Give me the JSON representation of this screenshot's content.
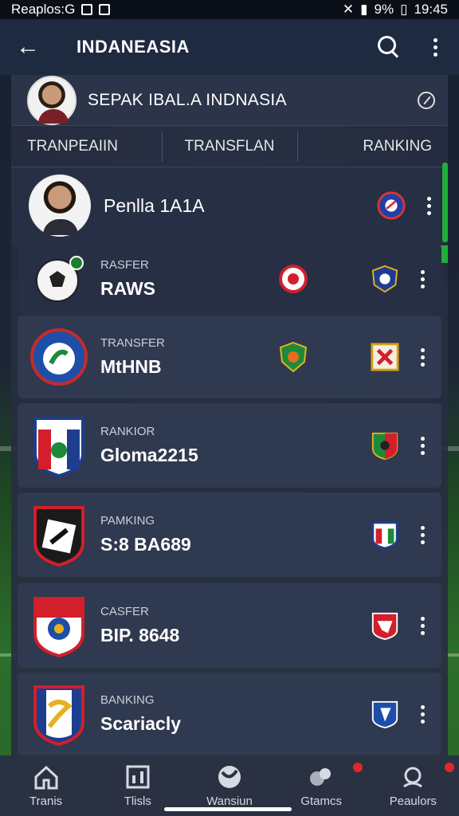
{
  "status_bar": {
    "left_text": "Reaplos:G",
    "battery": "9%",
    "time": "19:45"
  },
  "app_bar": {
    "title": "INDANEASIA"
  },
  "league": {
    "title": "SEPAK IBAL.A INDNASIA"
  },
  "tabs": [
    "TRANPEAIIN",
    "TRANSFLAN",
    "RANKING"
  ],
  "player": {
    "name": "Penlla 1A1A"
  },
  "rows": [
    {
      "category": "RASFER",
      "name": "RAWS"
    },
    {
      "category": "TRANSFER",
      "name": "MtHNB"
    },
    {
      "category": "RANKIOR",
      "name": "Gloma2215"
    },
    {
      "category": "PAMKING",
      "name": "S:8 BA689"
    },
    {
      "category": "CASFER",
      "name": "BIP. 8648"
    },
    {
      "category": "BANKING",
      "name": "Scariacly"
    }
  ],
  "bottom_nav": [
    {
      "label": "Tranis",
      "icon": "home-icon"
    },
    {
      "label": "Tlisls",
      "icon": "stats-icon"
    },
    {
      "label": "Wansiun",
      "icon": "ball-icon"
    },
    {
      "label": "Gtamcs",
      "icon": "players-icon"
    },
    {
      "label": "Peaulors",
      "icon": "profile-icon"
    }
  ],
  "colors": {
    "accent_green": "#1fae3a",
    "app_bar": "#1e2a40",
    "notification": "#e02828"
  }
}
